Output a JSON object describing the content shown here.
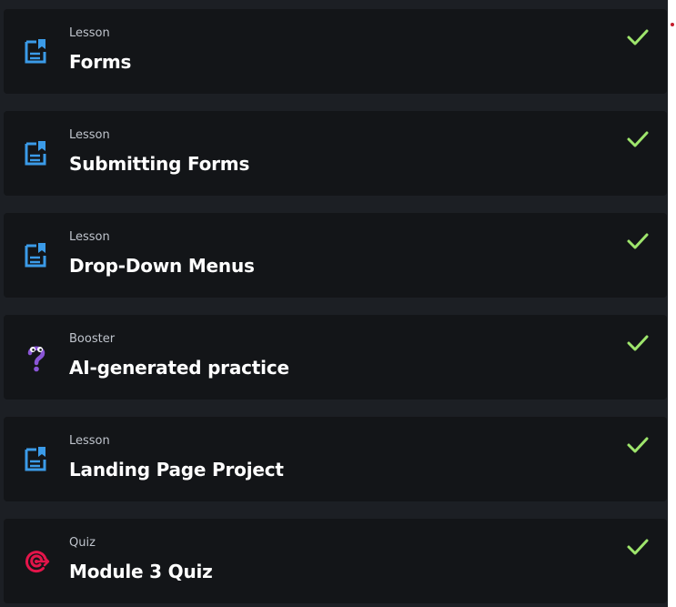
{
  "colors": {
    "page_background": "#1c1f24",
    "card_background": "#131518",
    "lesson_icon": "#3b9be8",
    "booster_icon": "#8a55d6",
    "quiz_icon": "#e3154a",
    "check": "#9ee56c",
    "title_text": "#ffffff",
    "kind_text": "#bfc4cc"
  },
  "items": [
    {
      "kind": "Lesson",
      "title": "Forms",
      "icon": "lesson-document-icon",
      "completed": true
    },
    {
      "kind": "Lesson",
      "title": "Submitting Forms",
      "icon": "lesson-document-icon",
      "completed": true
    },
    {
      "kind": "Lesson",
      "title": "Drop-Down Menus",
      "icon": "lesson-document-icon",
      "completed": true
    },
    {
      "kind": "Booster",
      "title": "AI-generated practice",
      "icon": "question-mark-creature-icon",
      "completed": true
    },
    {
      "kind": "Lesson",
      "title": "Landing Page Project",
      "icon": "lesson-document-icon",
      "completed": true
    },
    {
      "kind": "Quiz",
      "title": "Module 3 Quiz",
      "icon": "target-icon",
      "completed": true
    }
  ]
}
